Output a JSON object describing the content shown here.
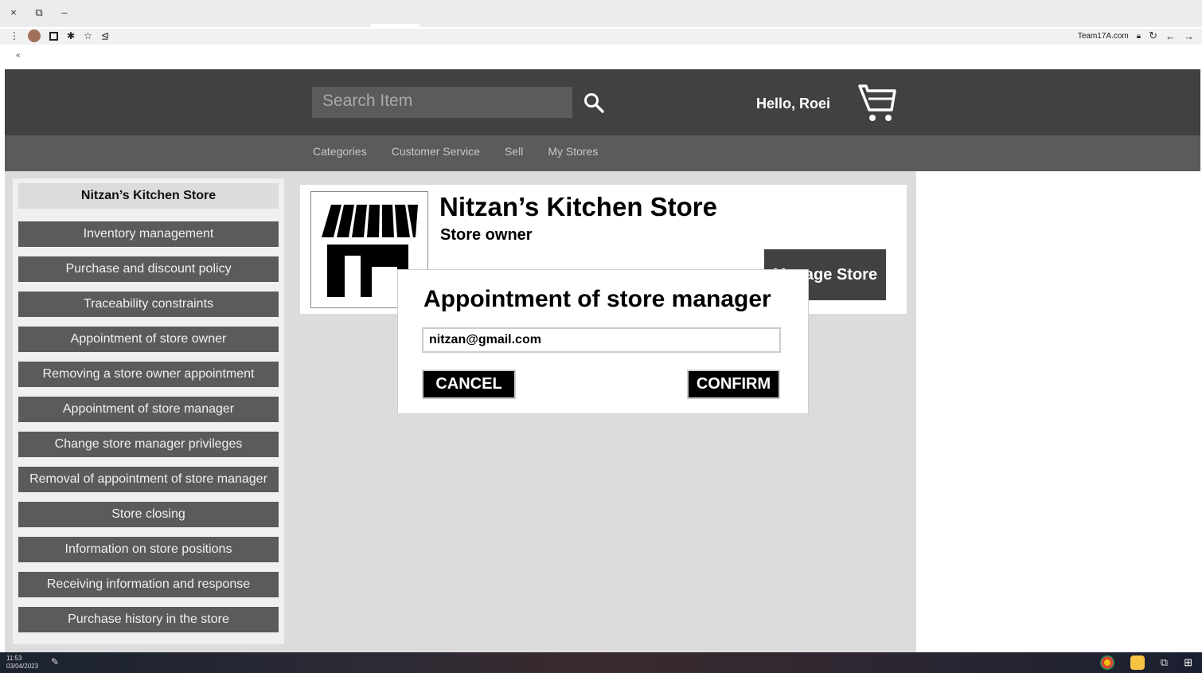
{
  "browser": {
    "window_controls": [
      "×",
      "⧉",
      "–"
    ],
    "url": "Team17A.com",
    "back_chevrons": "«"
  },
  "header": {
    "search_placeholder": "Search Item",
    "greeting": "Hello, Roei"
  },
  "nav": {
    "items": [
      "Categories",
      "Customer Service",
      "Sell",
      "My Stores"
    ]
  },
  "sidebar": {
    "title": "Nitzan’s Kitchen Store",
    "items": [
      "Inventory management",
      "Purchase and discount policy",
      "Traceability constraints",
      "Appointment of store owner",
      "Removing a store owner appointment",
      "Appointment of store manager",
      "Change store manager privileges",
      "Removal of appointment of store manager",
      "Store closing",
      "Information on store positions",
      "Receiving information and response",
      "Purchase history in the store"
    ]
  },
  "store": {
    "name": "Nitzan’s Kitchen Store",
    "role": "Store owner",
    "manage_label": "Manage Store"
  },
  "modal": {
    "title": "Appointment of store manager",
    "input_value": "nitzan@gmail.com",
    "cancel_label": "CANCEL",
    "confirm_label": "CONFIRM"
  },
  "taskbar": {
    "time": "11:53",
    "date": "03/04/2023"
  },
  "colors": {
    "header_bg": "#414141",
    "nav_bg": "#5b5b5b",
    "content_bg": "#dcdcdc",
    "button_black": "#000000"
  },
  "icons": [
    "search-icon",
    "cart-icon",
    "store-awning-icon",
    "lock-icon",
    "reload-icon",
    "back-arrow-icon",
    "forward-arrow-icon",
    "star-icon",
    "pin-icon",
    "extension-icon"
  ]
}
